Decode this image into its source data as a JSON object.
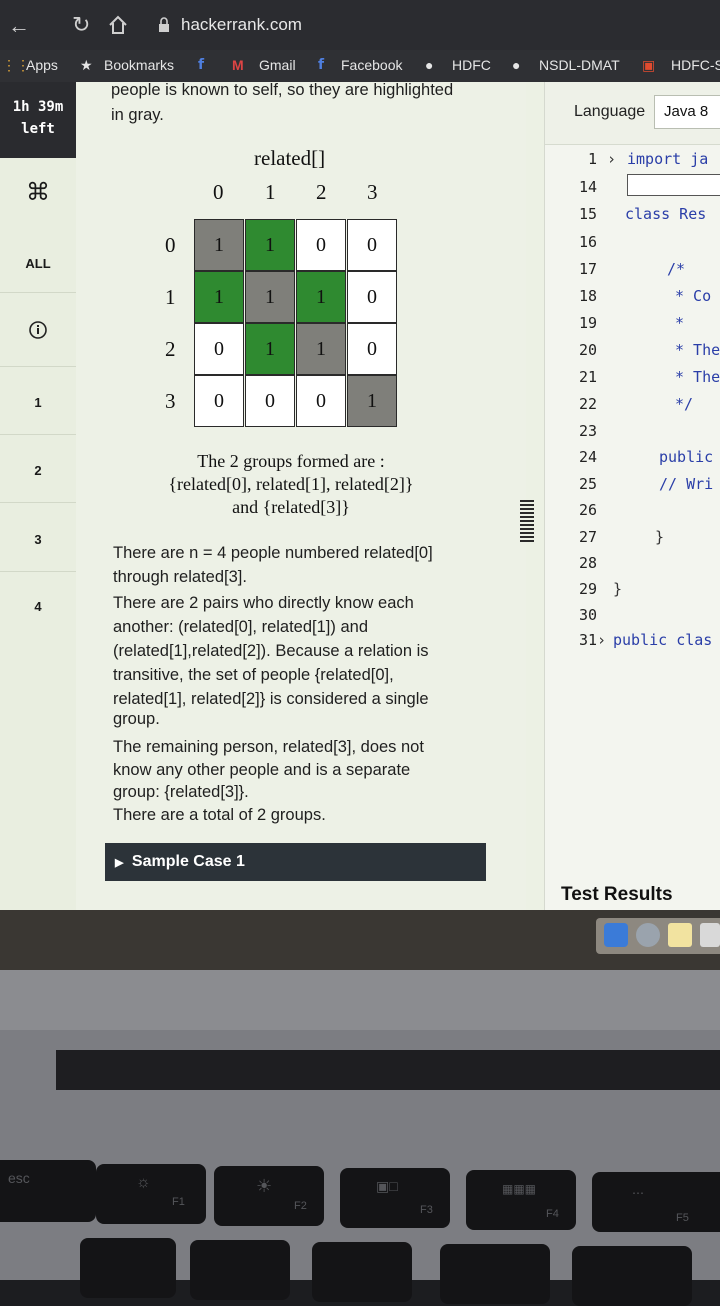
{
  "browser": {
    "url": "hackerrank.com",
    "bookmarks": [
      "Apps",
      "Bookmarks",
      "Gmail",
      "Facebook",
      "HDFC",
      "NSDL-DMAT",
      "HDFC-S"
    ]
  },
  "sidebar": {
    "timer_line1": "1h 39m",
    "timer_line2": "left",
    "all_label": "ALL",
    "questions": [
      "1",
      "2",
      "3",
      "4"
    ]
  },
  "problem": {
    "top_text_1": "people is known to self, so they are highlighted",
    "top_text_2": "in gray.",
    "matrix_title": "related[]",
    "col_headers": [
      "0",
      "1",
      "2",
      "3"
    ],
    "row_headers": [
      "0",
      "1",
      "2",
      "3"
    ],
    "matrix": [
      [
        "1",
        "1",
        "0",
        "0"
      ],
      [
        "1",
        "1",
        "1",
        "0"
      ],
      [
        "0",
        "1",
        "1",
        "0"
      ],
      [
        "0",
        "0",
        "0",
        "1"
      ]
    ],
    "groups_line1": "The 2 groups formed are :",
    "groups_line2": "{related[0], related[1], related[2]}",
    "groups_line3": "and {related[3]}",
    "explanation": [
      "There are n = 4 people numbered related[0]",
      "through related[3].",
      "There are 2 pairs who directly know each",
      "another: (related[0], related[1]) and",
      "(related[1],related[2]). Because a relation is",
      "transitive, the set of people {related[0],",
      "related[1], related[2]} is considered a single",
      "group.",
      "The remaining person, related[3], does not",
      "know any other people and is a separate",
      "group: {related[3]}.",
      "There are a total of 2 groups."
    ],
    "sample_case": "Sample Case 1"
  },
  "editor": {
    "language_label": "Language",
    "language_value": "Java 8",
    "lines": [
      {
        "num": "1",
        "code": "import ja",
        "fold": true
      },
      {
        "num": "14",
        "code": ""
      },
      {
        "num": "15",
        "code": "class Res"
      },
      {
        "num": "16",
        "code": ""
      },
      {
        "num": "17",
        "code": "/*"
      },
      {
        "num": "18",
        "code": "* Co"
      },
      {
        "num": "19",
        "code": "*"
      },
      {
        "num": "20",
        "code": "* The"
      },
      {
        "num": "21",
        "code": "* The"
      },
      {
        "num": "22",
        "code": "*/"
      },
      {
        "num": "23",
        "code": ""
      },
      {
        "num": "24",
        "code": "public"
      },
      {
        "num": "25",
        "code": "// Wri"
      },
      {
        "num": "26",
        "code": ""
      },
      {
        "num": "27",
        "code": "}"
      },
      {
        "num": "28",
        "code": ""
      },
      {
        "num": "29",
        "code": "}"
      },
      {
        "num": "30",
        "code": ""
      },
      {
        "num": "31",
        "code": "public clas",
        "fold": true
      }
    ],
    "test_results": "Test Results"
  },
  "keyboard": {
    "keys": [
      "esc",
      "F1",
      "F2",
      "F3",
      "F4",
      "F5"
    ]
  },
  "colors": {
    "related_green": "#2f8a30",
    "self_gray": "#7f7f7a",
    "code_blue": "#2a3ea8"
  }
}
